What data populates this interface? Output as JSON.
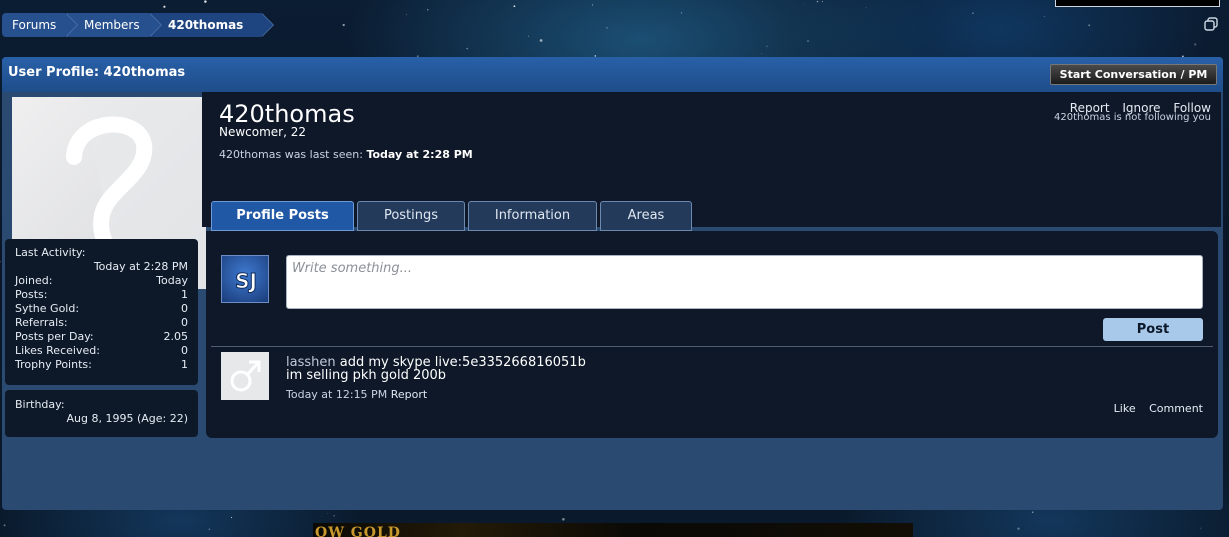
{
  "breadcrumb": {
    "items": [
      "Forums",
      "Members"
    ],
    "current": "420thomas"
  },
  "header": {
    "title": "User Profile: 420thomas",
    "start_conversation": "Start Conversation / PM"
  },
  "profile": {
    "username": "420thomas",
    "user_title": "Newcomer, 22",
    "last_seen_label": "420thomas was last seen:",
    "last_seen_value": "Today at 2:28 PM",
    "actions": [
      "Report",
      "Ignore",
      "Follow"
    ],
    "follow_note": "420thomas is not following you"
  },
  "stats": {
    "last_activity_label": "Last Activity:",
    "last_activity_value": "Today at 2:28 PM",
    "rows": [
      {
        "label": "Joined:",
        "value": "Today"
      },
      {
        "label": "Posts:",
        "value": "1"
      },
      {
        "label": "Sythe Gold:",
        "value": "0"
      },
      {
        "label": "Referrals:",
        "value": "0"
      },
      {
        "label": "Posts per Day:",
        "value": "2.05"
      },
      {
        "label": "Likes Received:",
        "value": "0"
      },
      {
        "label": "Trophy Points:",
        "value": "1"
      }
    ],
    "birthday_label": "Birthday:",
    "birthday_value": "Aug 8, 1995 (Age: 22)"
  },
  "tabs": [
    "Profile Posts",
    "Postings",
    "Information",
    "Areas"
  ],
  "composer": {
    "avatar_text": "SJ",
    "placeholder": "Write something...",
    "post_label": "Post"
  },
  "post": {
    "author": "lasshen",
    "line1": "add my skype live:5e335266816051b",
    "line2": "im selling pkh gold 200b",
    "time": "Today at 12:15 PM",
    "report": "Report",
    "like": "Like",
    "comment": "Comment"
  },
  "banner": {
    "text": "OW GOLD"
  },
  "colors": {
    "accent": "#2158a5",
    "panel": "#2b4a72",
    "content_bg": "#0e1829"
  }
}
